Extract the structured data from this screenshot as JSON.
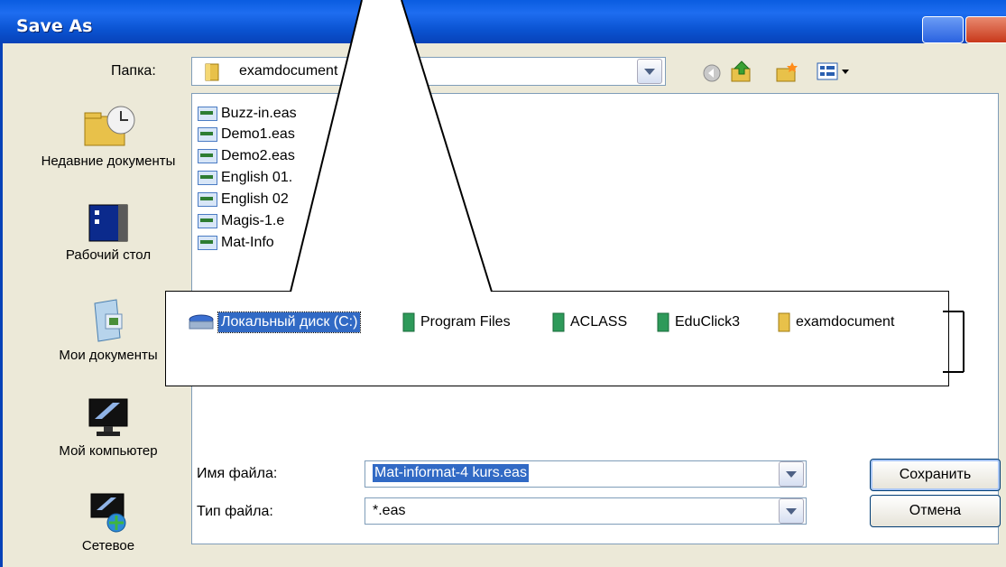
{
  "window": {
    "title": "Save As"
  },
  "toolbar": {
    "lookin_label": "Папка:",
    "lookin_value": "examdocument",
    "icons": [
      "back-icon",
      "up-folder-icon",
      "new-folder-icon",
      "view-menu-icon"
    ]
  },
  "places": [
    {
      "label": "Недавние документы",
      "icon": "recent-documents-icon"
    },
    {
      "label": "Рабочий стол",
      "icon": "desktop-icon"
    },
    {
      "label": "Мои документы",
      "icon": "my-documents-icon"
    },
    {
      "label": "Мой компьютер",
      "icon": "my-computer-icon"
    },
    {
      "label": "Сетевое",
      "icon": "network-icon"
    }
  ],
  "files": [
    {
      "name": "Buzz-in.eas"
    },
    {
      "name": "Demo1.eas"
    },
    {
      "name": "Demo2.eas"
    },
    {
      "name": "English 01."
    },
    {
      "name": "English 02"
    },
    {
      "name": "Magis-1.e"
    },
    {
      "name": "Mat-Info"
    }
  ],
  "callout": {
    "breadcrumb": [
      {
        "label": "Локальный диск (C:)",
        "icon": "drive-icon",
        "selected": true
      },
      {
        "label": "Program Files",
        "icon": "folder-icon"
      },
      {
        "label": "ACLASS",
        "icon": "folder-icon"
      },
      {
        "label": "EduClick3",
        "icon": "folder-icon"
      },
      {
        "label": "examdocument",
        "icon": "folder-icon"
      }
    ]
  },
  "form": {
    "filename_label": "Имя файла:",
    "filename_value": "Mat-informat-4 kurs.eas",
    "filetype_label": "Тип файла:",
    "filetype_value": "*.eas",
    "save_button": "Сохранить",
    "cancel_button": "Отмена"
  },
  "colors": {
    "title_bar": "#0a5ce0",
    "selection": "#316ac5",
    "dialog_bg": "#ece9d8"
  }
}
